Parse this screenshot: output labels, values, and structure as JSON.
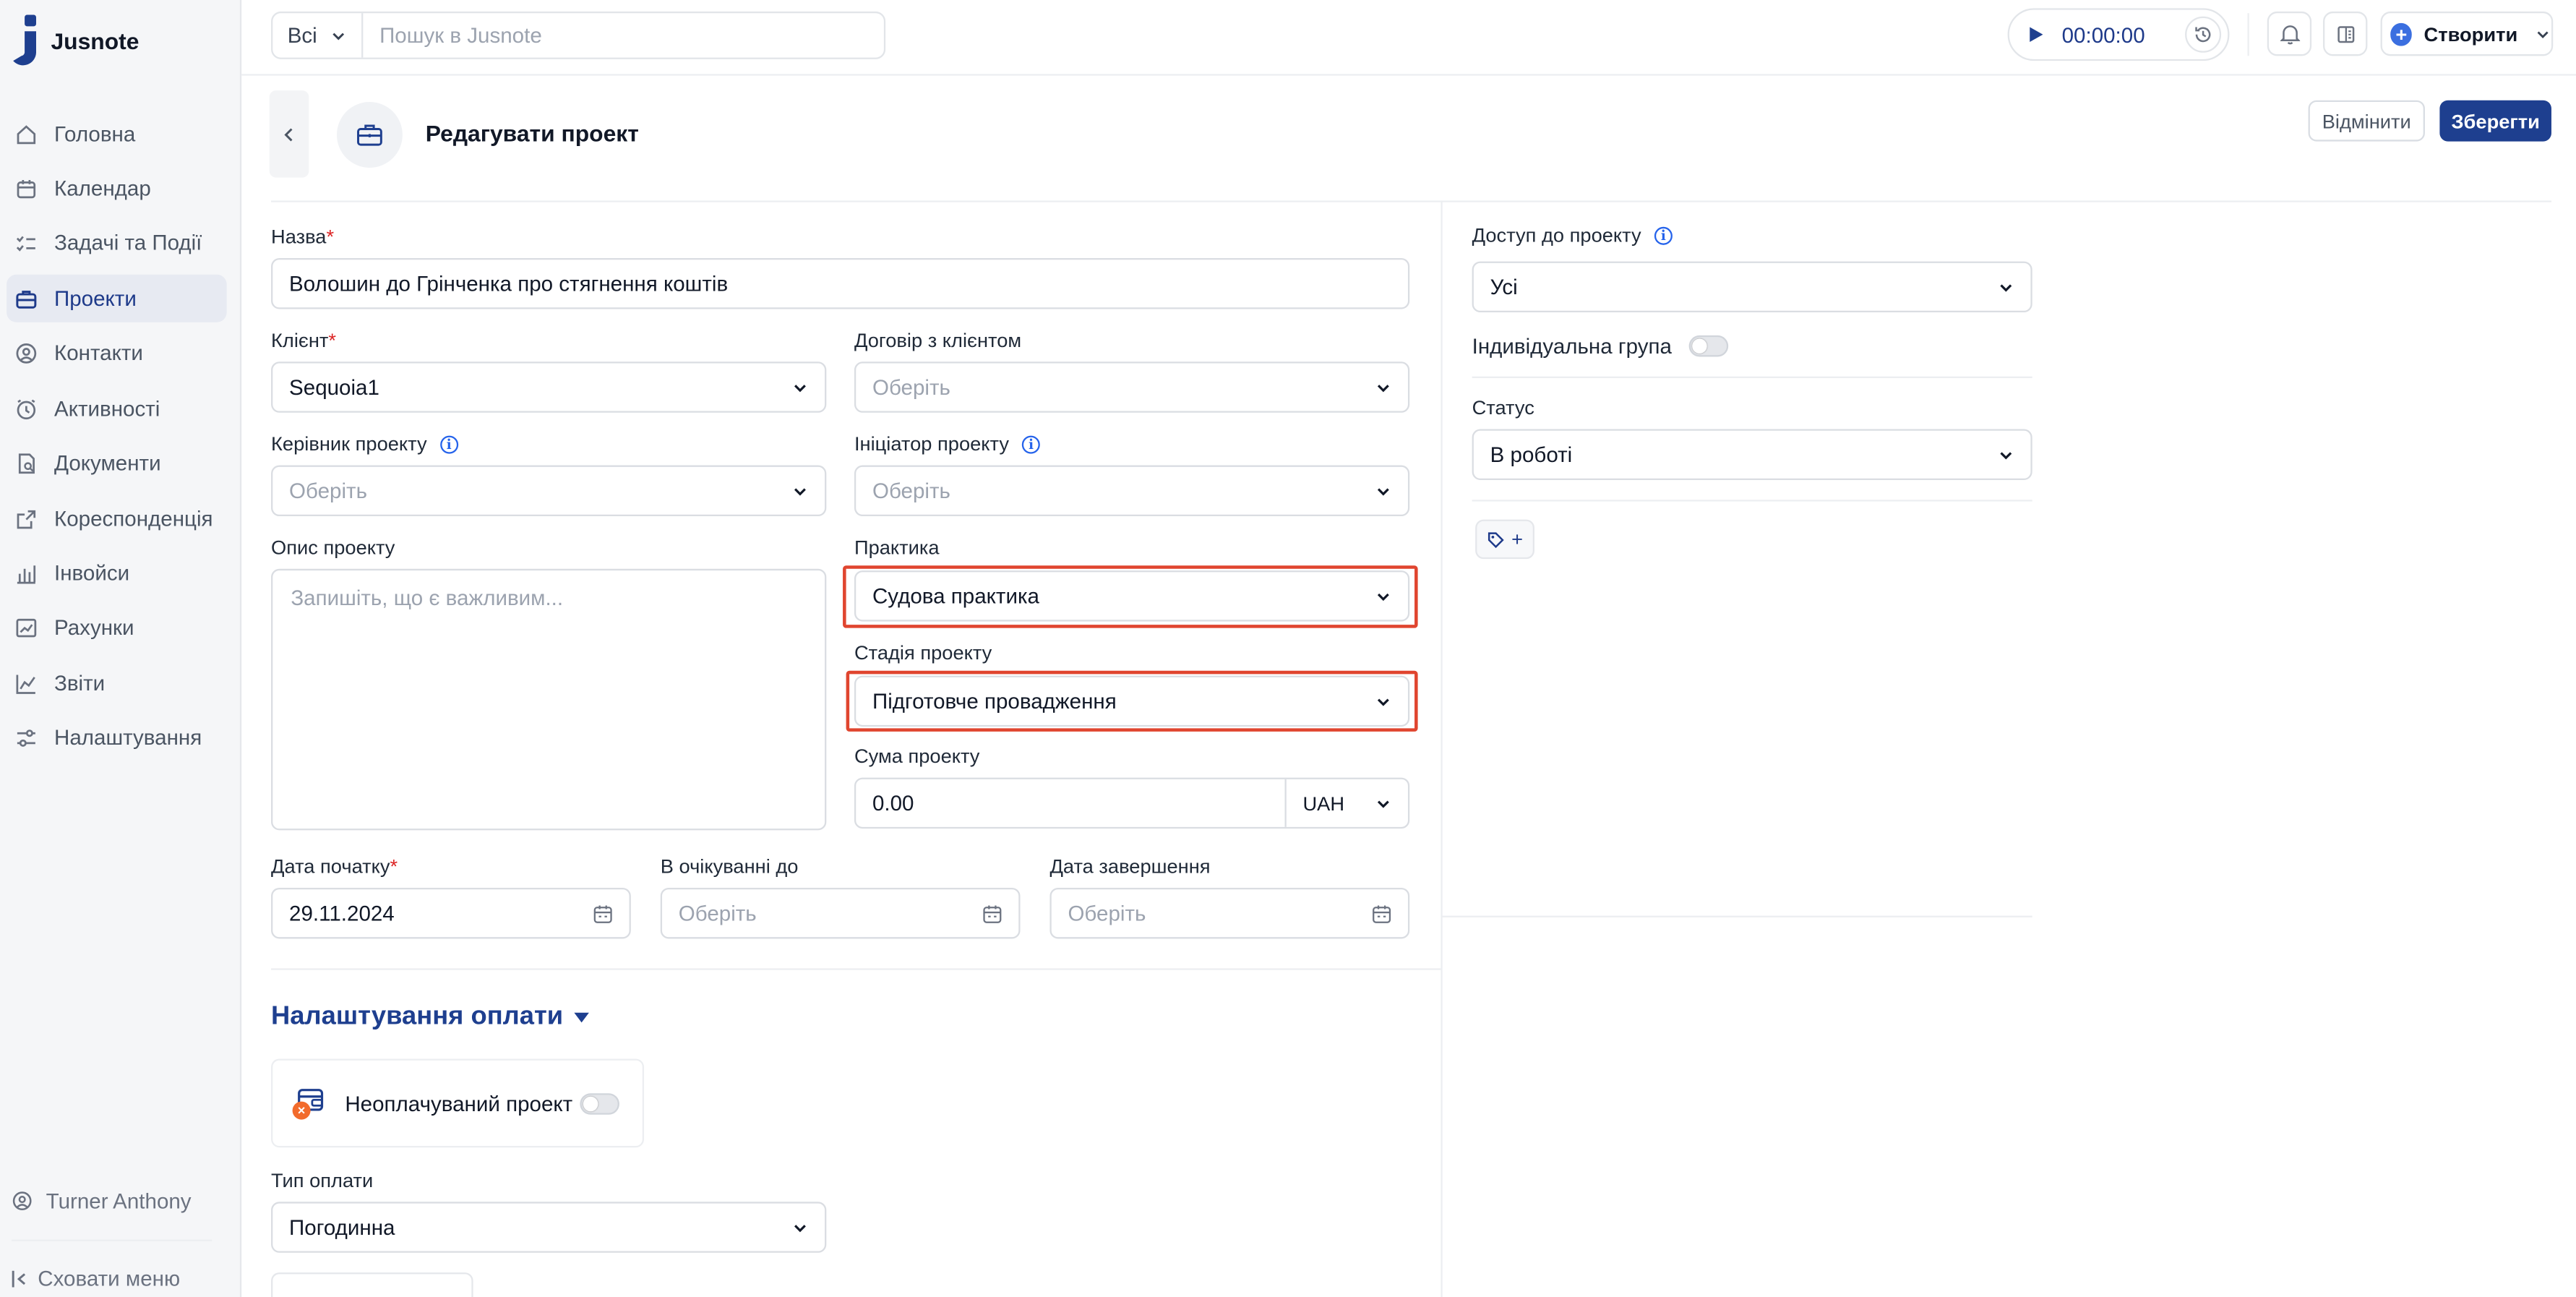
{
  "app": {
    "name": "Jusnote"
  },
  "sidebar": {
    "items": [
      {
        "label": "Головна",
        "icon": "home-icon"
      },
      {
        "label": "Календар",
        "icon": "calendar-icon"
      },
      {
        "label": "Задачі та Події",
        "icon": "tasks-icon"
      },
      {
        "label": "Проекти",
        "icon": "briefcase-icon",
        "active": true
      },
      {
        "label": "Контакти",
        "icon": "contacts-icon"
      },
      {
        "label": "Активності",
        "icon": "clock-icon"
      },
      {
        "label": "Документи",
        "icon": "document-icon"
      },
      {
        "label": "Кореспонденція",
        "icon": "mail-icon"
      },
      {
        "label": "Інвойси",
        "icon": "invoice-icon"
      },
      {
        "label": "Рахунки",
        "icon": "bill-icon"
      },
      {
        "label": "Звіти",
        "icon": "report-icon"
      },
      {
        "label": "Налаштування",
        "icon": "settings-icon"
      }
    ],
    "user": "Turner Anthony",
    "collapse_label": "Сховати меню"
  },
  "topbar": {
    "search_scope": "Всі",
    "search_placeholder": "Пошук в Jusnote",
    "timer": "00:00:00",
    "create_label": "Створити"
  },
  "header": {
    "title": "Редагувати проект",
    "cancel_label": "Відмінити",
    "save_label": "Зберегти"
  },
  "form": {
    "name": {
      "label": "Назва",
      "value": "Волошин до Грінченка про стягнення коштів"
    },
    "client": {
      "label": "Клієнт",
      "value": "Sequoia1"
    },
    "contract": {
      "label": "Договір з клієнтом",
      "placeholder": "Оберіть"
    },
    "manager": {
      "label": "Керівник проекту",
      "placeholder": "Оберіть"
    },
    "initiator": {
      "label": "Ініціатор проекту",
      "placeholder": "Оберіть"
    },
    "description": {
      "label": "Опис проекту",
      "placeholder": "Запишіть, що є важливим..."
    },
    "practice": {
      "label": "Практика",
      "value": "Судова практика"
    },
    "stage": {
      "label": "Стадія проекту",
      "value": "Підготовче провадження"
    },
    "amount": {
      "label": "Сума проекту",
      "value": "0.00",
      "currency": "UAH"
    },
    "start_date": {
      "label": "Дата початку",
      "value": "29.11.2024"
    },
    "pending_until": {
      "label": "В очікуванні до",
      "placeholder": "Оберіть"
    },
    "end_date": {
      "label": "Дата завершення",
      "placeholder": "Оберіть"
    }
  },
  "billing": {
    "title": "Налаштування оплати",
    "unpaid_label": "Неоплачуваний проект",
    "payment_type_label": "Тип оплати",
    "payment_type_value": "Погодинна"
  },
  "right": {
    "access": {
      "label": "Доступ до проекту",
      "value": "Усі"
    },
    "individual_group_label": "Індивідуальна група",
    "status": {
      "label": "Статус",
      "value": "В роботі"
    },
    "tag_add": "+"
  },
  "colors": {
    "accent": "#1e3f8f",
    "highlight": "#e0452f",
    "required": "#dc2626"
  }
}
